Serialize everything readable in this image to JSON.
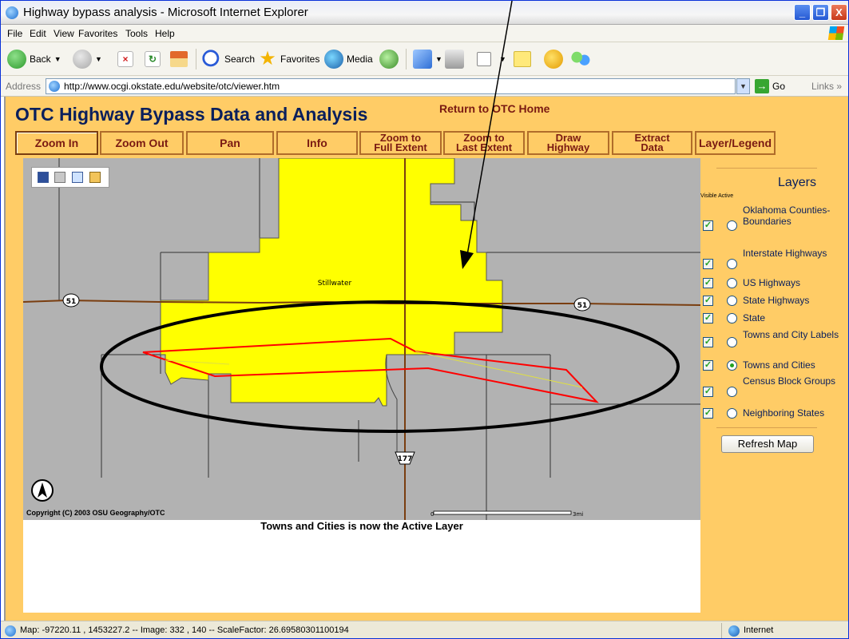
{
  "window": {
    "title": "Highway bypass analysis - Microsoft Internet Explorer",
    "min_label": "_",
    "restore_label": "❐",
    "close_label": "X"
  },
  "menu": [
    "File",
    "Edit",
    "View",
    "Favorites",
    "Tools",
    "Help"
  ],
  "toolbar": {
    "back": "Back",
    "search": "Search",
    "favorites": "Favorites",
    "media": "Media"
  },
  "address": {
    "label": "Address",
    "url": "http://www.ocgi.okstate.edu/website/otc/viewer.htm",
    "go": "Go",
    "links": "Links"
  },
  "page": {
    "title": "OTC Highway Bypass Data and Analysis",
    "home_link": "Return to OTC Home",
    "nav": [
      {
        "line1": "Zoom In",
        "line2": ""
      },
      {
        "line1": "Zoom Out",
        "line2": ""
      },
      {
        "line1": "Pan",
        "line2": ""
      },
      {
        "line1": "Info",
        "line2": ""
      },
      {
        "line1": "Zoom to",
        "line2": "Full Extent"
      },
      {
        "line1": "Zoom to",
        "line2": "Last Extent"
      },
      {
        "line1": "Draw",
        "line2": "Highway"
      },
      {
        "line1": "Extract",
        "line2": "Data"
      },
      {
        "line1": "Layer/Legend",
        "line2": ""
      }
    ],
    "status_message": "Towns and Cities is now the Active Layer"
  },
  "map": {
    "city_label": "Stillwater",
    "shield_west": "51",
    "shield_east": "51",
    "shield_south": "177",
    "scale_start": "0",
    "scale_end": "3mi",
    "copyright": "Copyright (C) 2003 OSU Geography/OTC",
    "colors": {
      "background": "#b2b2b2",
      "town": "#ffff00",
      "state_highway": "#7a3e10",
      "bypass": "#ff0000",
      "annotation": "#000000"
    }
  },
  "layers": {
    "title": "Layers",
    "col_visible": "Visible",
    "col_active": "Active",
    "items": [
      {
        "label": "Oklahoma Counties-Boundaries",
        "visible": true,
        "active": false
      },
      {
        "label": "Interstate Highways",
        "visible": true,
        "active": false
      },
      {
        "label": "US Highways",
        "visible": true,
        "active": false
      },
      {
        "label": "State Highways",
        "visible": true,
        "active": false
      },
      {
        "label": "State",
        "visible": true,
        "active": false
      },
      {
        "label": "Towns and City Labels",
        "visible": true,
        "active": false
      },
      {
        "label": "Towns and Cities",
        "visible": true,
        "active": true
      },
      {
        "label": "Census Block Groups",
        "visible": true,
        "active": false
      },
      {
        "label": "Neighboring States",
        "visible": true,
        "active": false
      }
    ],
    "refresh": "Refresh Map"
  },
  "statusbar": {
    "text": "Map: -97220.11 , 1453227.2 -- Image: 332 , 140 -- ScaleFactor: 26.69580301100194",
    "zone": "Internet"
  }
}
